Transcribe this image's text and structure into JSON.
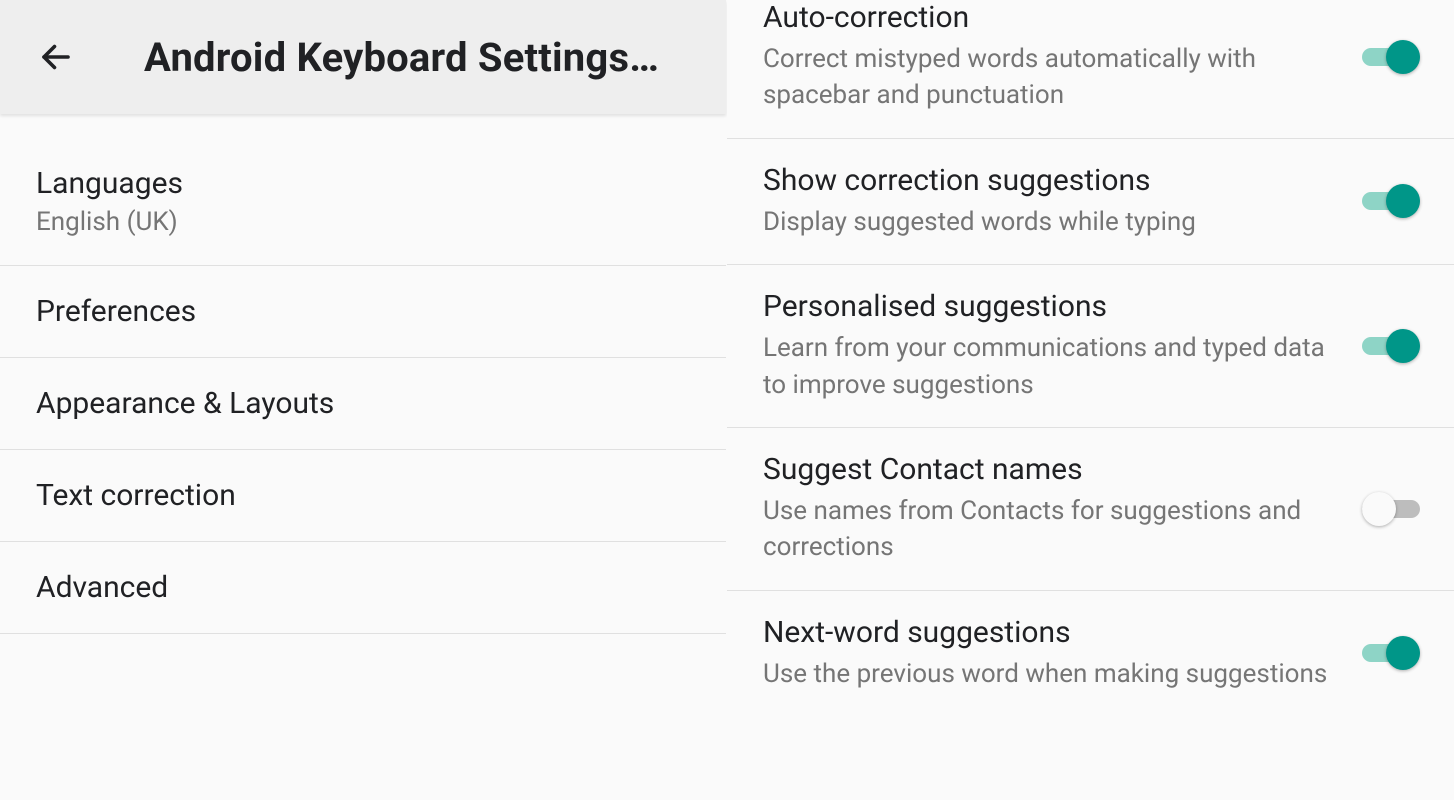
{
  "header": {
    "title": "Android Keyboard Settings…"
  },
  "left": {
    "items": [
      {
        "label": "Languages",
        "sub": "English (UK)"
      },
      {
        "label": "Preferences"
      },
      {
        "label": "Appearance & Layouts"
      },
      {
        "label": "Text correction"
      },
      {
        "label": "Advanced"
      }
    ]
  },
  "right": {
    "items": [
      {
        "label": "Auto-correction",
        "sub": "Correct mistyped words automatically with spacebar and punctuation",
        "on": true
      },
      {
        "label": "Show correction suggestions",
        "sub": "Display suggested words while typing",
        "on": true
      },
      {
        "label": "Personalised suggestions",
        "sub": "Learn from your communications and typed data to improve suggestions",
        "on": true
      },
      {
        "label": "Suggest Contact names",
        "sub": "Use names from Contacts for suggestions and corrections",
        "on": false
      },
      {
        "label": "Next-word suggestions",
        "sub": "Use the previous word when making suggestions",
        "on": true
      }
    ]
  }
}
